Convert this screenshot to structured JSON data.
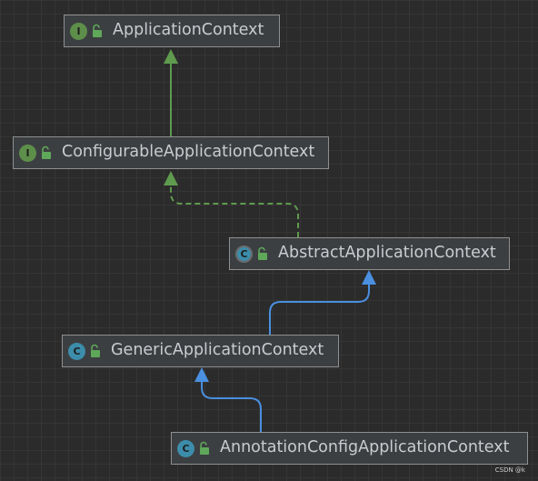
{
  "nodes": [
    {
      "label": "ApplicationContext",
      "kind_letter": "I",
      "kind": "interface"
    },
    {
      "label": "ConfigurableApplicationContext",
      "kind_letter": "I",
      "kind": "interface"
    },
    {
      "label": "AbstractApplicationContext",
      "kind_letter": "C",
      "kind": "abstract-class"
    },
    {
      "label": "GenericApplicationContext",
      "kind_letter": "C",
      "kind": "class"
    },
    {
      "label": "AnnotationConfigApplicationContext",
      "kind_letter": "C",
      "kind": "class"
    }
  ],
  "edges": [
    {
      "from": "ConfigurableApplicationContext",
      "to": "ApplicationContext",
      "relation": "extends",
      "style": "solid",
      "color": "#5f9a4e"
    },
    {
      "from": "AbstractApplicationContext",
      "to": "ConfigurableApplicationContext",
      "relation": "implements",
      "style": "dashed",
      "color": "#5f9a4e"
    },
    {
      "from": "GenericApplicationContext",
      "to": "AbstractApplicationContext",
      "relation": "extends",
      "style": "solid",
      "color": "#4a8fe0"
    },
    {
      "from": "AnnotationConfigApplicationContext",
      "to": "GenericApplicationContext",
      "relation": "extends",
      "style": "solid",
      "color": "#4a8fe0"
    }
  ],
  "colors": {
    "background": "#2b2b2b",
    "interface_badge": "#5d8f4a",
    "class_badge": "#3c8dab",
    "lock_icon": "#5fa85a"
  },
  "watermark": "CSDN @k"
}
